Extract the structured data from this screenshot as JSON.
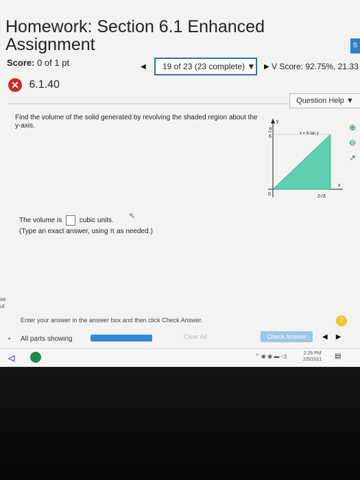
{
  "header": {
    "title": "Homework: Section 6.1 Enhanced Assignment",
    "side_button": "S"
  },
  "score": {
    "label": "Score:",
    "value": "0 of 1 pt",
    "progress_select": "19 of 23 (23 complete) ▼",
    "hw_score": "V Score: 92.75%, 21.33"
  },
  "question": {
    "id": "6.1.40",
    "help_label": "Question Help ▼",
    "text": "Find the volume of the solid generated by revolving the shaded region about the y-axis.",
    "graph": {
      "y_axis_label": "y",
      "x_axis_label": "x",
      "y_tick_top": "π",
      "y_tick_bottom": "6",
      "origin": "0",
      "x_tick": "2√3",
      "curve_label": "x = 6 tan y"
    },
    "answer_prefix": "The volume is",
    "answer_suffix": "cubic units.",
    "answer_value": "",
    "answer_hint": "(Type an exact answer, using π as needed.)"
  },
  "footer": {
    "instruction": "Enter your answer in the answer box and then click Check Answer.",
    "parts": "All parts showing",
    "parts_progress": 1.0,
    "clear_label": "Clear All",
    "check_label": "Check Answer"
  },
  "taskbar": {
    "time": "2:26 PM",
    "date": "2/5/2021"
  },
  "left_edge": [
    "se",
    "ut"
  ],
  "colors": {
    "accent": "#2f6fb4",
    "shaded_region": "#5ed0b0",
    "error": "#cc2b2b",
    "check_button": "#9cc5e8"
  },
  "icons": [
    "x-circle-icon",
    "zoom-in-icon",
    "zoom-out-icon",
    "external-link-icon",
    "help-icon"
  ]
}
